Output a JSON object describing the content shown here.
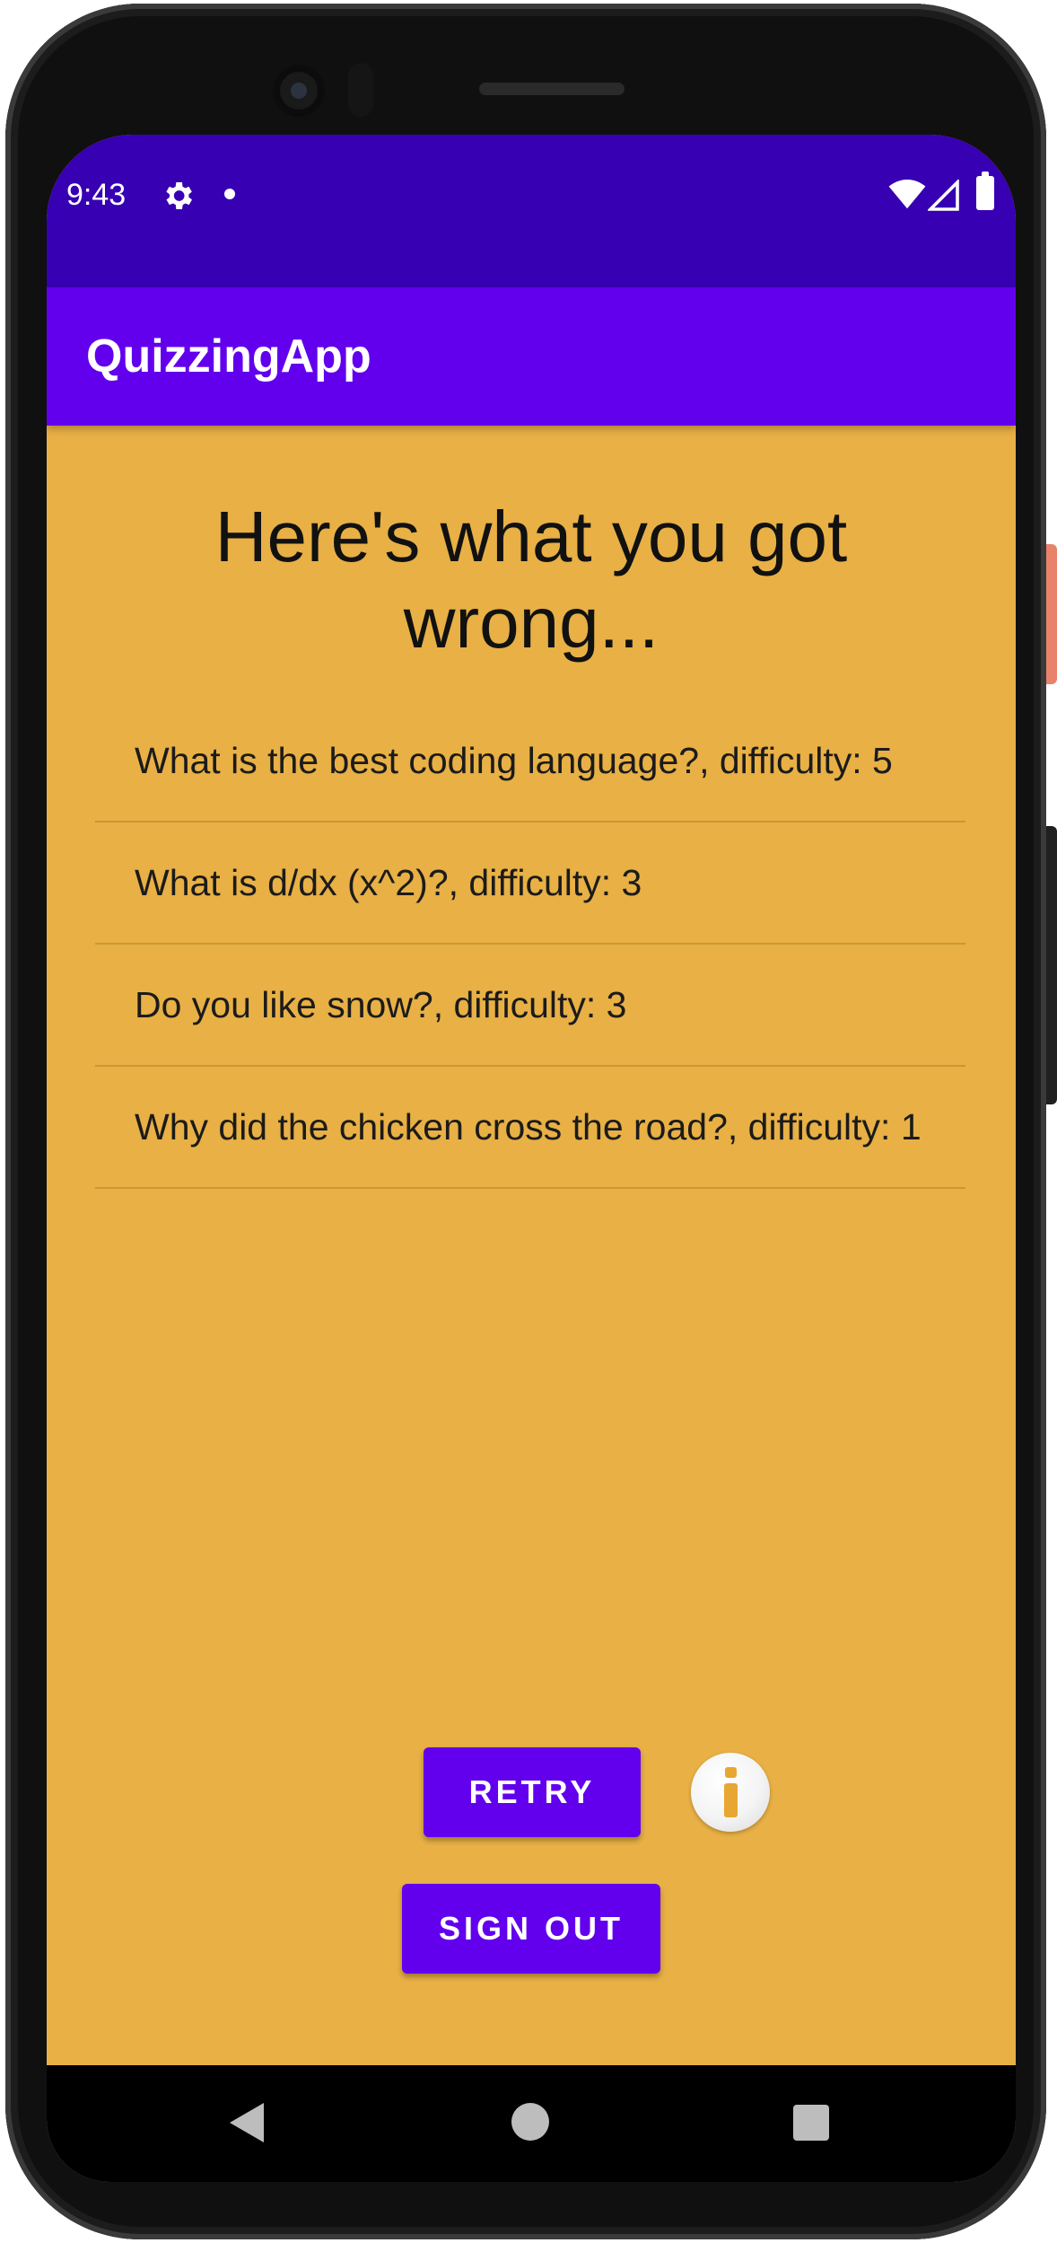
{
  "status_bar": {
    "time": "9:43",
    "icons": [
      "gear-icon",
      "dot-icon",
      "wifi-icon",
      "signal-icon",
      "battery-icon"
    ]
  },
  "app_bar": {
    "title": "QuizzingApp",
    "color": "#6200ee"
  },
  "main": {
    "background": "#e8b045",
    "heading": "Here's what you got wrong...",
    "wrong_answers": [
      "What is the best coding language?, difficulty: 5",
      "What is d/dx (x^2)?, difficulty: 3",
      "Do you like snow?, difficulty: 3",
      "Why did the chicken cross the road?, difficulty: 1"
    ],
    "retry_label": "RETRY",
    "signout_label": "SIGN OUT",
    "info_icon": "info-icon"
  },
  "nav_bar": {
    "icons": [
      "back-icon",
      "home-icon",
      "recents-icon"
    ]
  }
}
